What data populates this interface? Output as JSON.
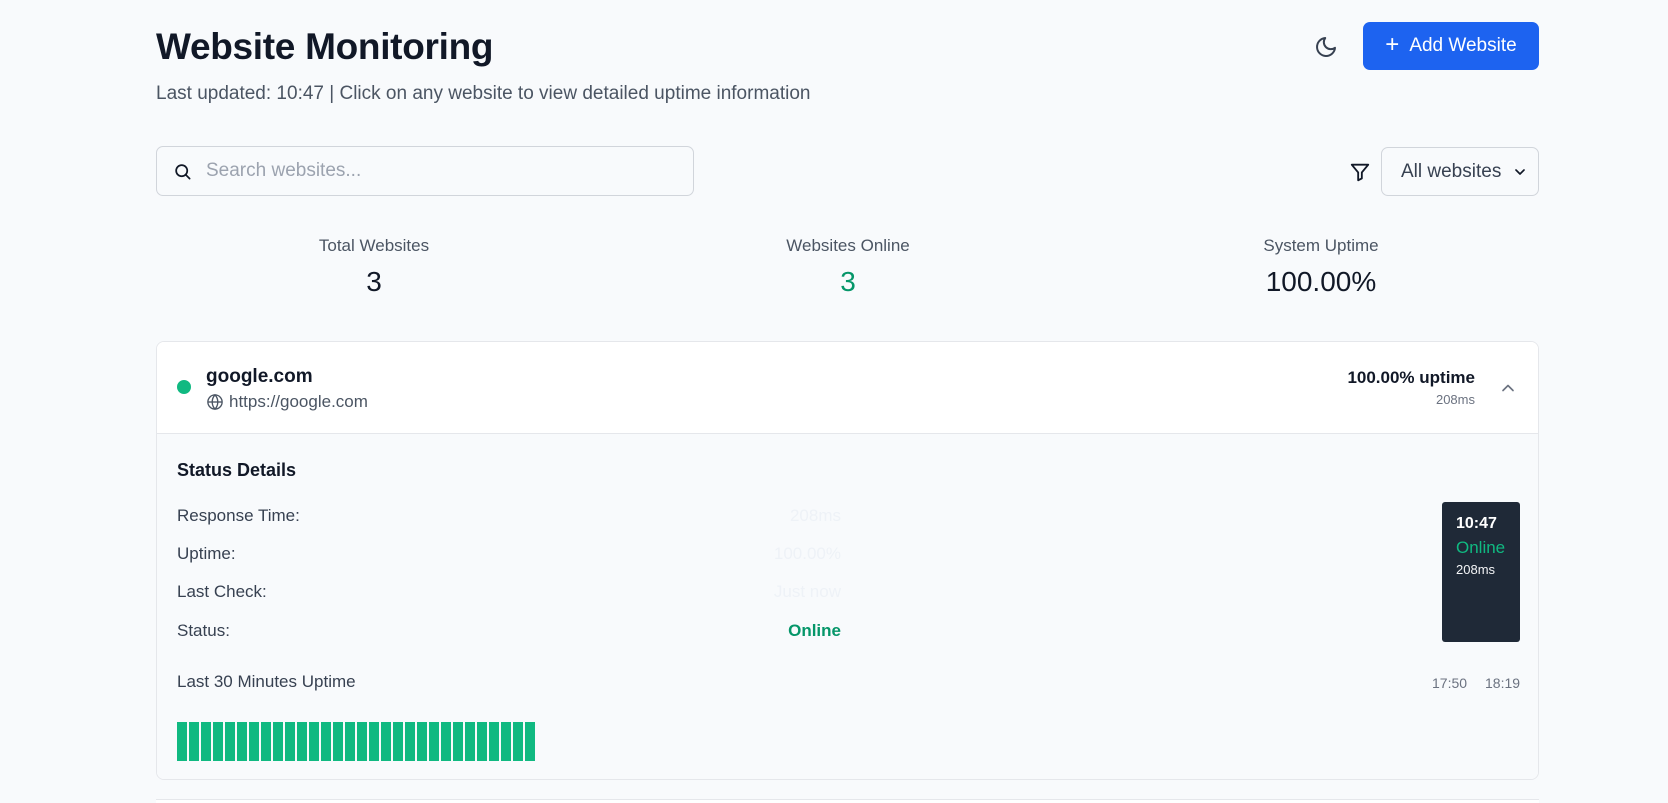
{
  "header": {
    "title": "Website Monitoring",
    "subtitle": "Last updated: 10:47 | Click on any website to view detailed uptime information",
    "add_button_label": "Add Website",
    "theme_icon": "moon-icon"
  },
  "search": {
    "placeholder": "Search websites...",
    "value": ""
  },
  "filter": {
    "selected": "All websites"
  },
  "stats": {
    "total_label": "Total Websites",
    "total_value": "3",
    "online_label": "Websites Online",
    "online_value": "3",
    "uptime_label": "System Uptime",
    "uptime_value": "100.00%"
  },
  "website": {
    "name": "google.com",
    "url": "https://google.com",
    "uptime": "100.00% uptime",
    "response": "208ms",
    "status_color": "#10b981",
    "details": {
      "title": "Status Details",
      "rows": [
        {
          "label": "Response Time:",
          "value": "208ms"
        },
        {
          "label": "Uptime:",
          "value": "100.00%"
        },
        {
          "label": "Last Check:",
          "value": "Just now"
        },
        {
          "label": "Status:",
          "value": "Online"
        }
      ]
    },
    "tooltip": {
      "time": "10:47",
      "status": "Online",
      "response": "208ms"
    },
    "history": {
      "label": "Last 30 Minutes Uptime",
      "start_time": "17:50",
      "end_time": "18:19",
      "bar_count": 30,
      "bar_color": "#10b981"
    }
  },
  "colors": {
    "accent": "#1d63f0",
    "online": "#059669"
  }
}
